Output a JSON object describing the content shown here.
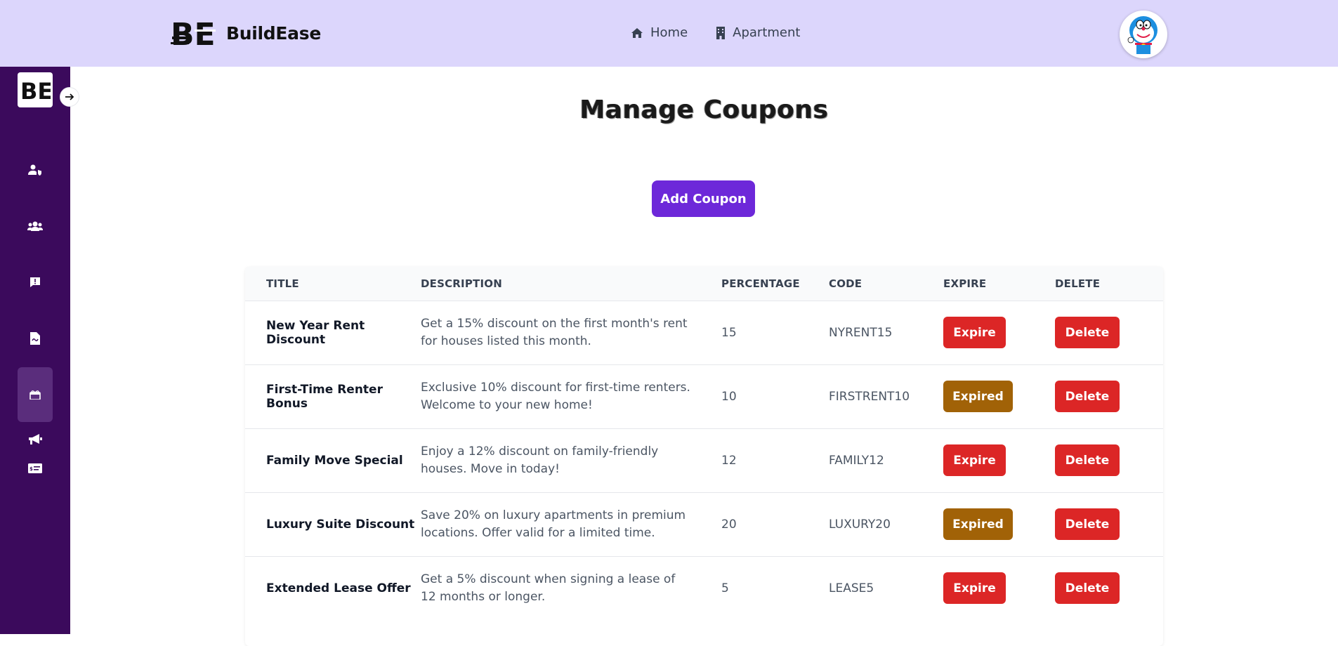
{
  "brand": {
    "name": "BuildEase",
    "logo_text": "BE"
  },
  "nav": [
    {
      "label": "Home",
      "icon": "home-icon"
    },
    {
      "label": "Apartment",
      "icon": "building-icon"
    }
  ],
  "sidebar": {
    "items": [
      {
        "icon": "user-shield-icon"
      },
      {
        "icon": "users-icon"
      },
      {
        "icon": "alert-message-icon"
      },
      {
        "icon": "file-invoice-icon"
      },
      {
        "icon": "gift-icon",
        "active": true
      },
      {
        "icon": "megaphone-icon"
      },
      {
        "icon": "money-check-icon"
      }
    ]
  },
  "page": {
    "title": "Manage Coupons",
    "add_button": "Add Coupon"
  },
  "table": {
    "headers": [
      "TITLE",
      "DESCRIPTION",
      "PERCENTAGE",
      "CODE",
      "EXPIRE",
      "DELETE"
    ],
    "rows": [
      {
        "title": "New Year Rent Discount",
        "description": "Get a 15% discount on the first month's rent for houses listed this month.",
        "percentage": "15",
        "code": "NYRENT15",
        "expire": "Expire",
        "delete": "Delete"
      },
      {
        "title": "First-Time Renter Bonus",
        "description": "Exclusive 10% discount for first-time renters. Welcome to your new home!",
        "percentage": "10",
        "code": "FIRSTRENT10",
        "expire": "Expired",
        "delete": "Delete"
      },
      {
        "title": "Family Move Special",
        "description": "Enjoy a 12% discount on family-friendly houses. Move in today!",
        "percentage": "12",
        "code": "FAMILY12",
        "expire": "Expire",
        "delete": "Delete"
      },
      {
        "title": "Luxury Suite Discount",
        "description": "Save 20% on luxury apartments in premium locations. Offer valid for a limited time.",
        "percentage": "20",
        "code": "LUXURY20",
        "expire": "Expired",
        "delete": "Delete"
      },
      {
        "title": "Extended Lease Offer",
        "description": "Get a 5% discount when signing a lease of 12 months or longer.",
        "percentage": "5",
        "code": "LEASE5",
        "expire": "Expire",
        "delete": "Delete"
      }
    ]
  },
  "colors": {
    "topbar": "#dcd6fc",
    "sidebar": "#3b0a5c",
    "primary": "#6d28d9",
    "danger": "#dc2626",
    "expired": "#a16207"
  }
}
